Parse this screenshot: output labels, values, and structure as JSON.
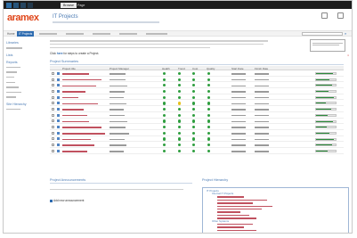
{
  "ribbon": {
    "tabs": [
      {
        "label": "Browse",
        "active": true
      },
      {
        "label": "Page",
        "active": false
      }
    ]
  },
  "header": {
    "logo": "aramex",
    "title": "IT Projects"
  },
  "tabs": [
    {
      "label": "Home",
      "active": false
    },
    {
      "label": "IT Projects",
      "active": true
    },
    {
      "label": "",
      "active": false
    },
    {
      "label": "",
      "active": false
    },
    {
      "label": "",
      "active": false
    },
    {
      "label": "",
      "active": false
    },
    {
      "label": "",
      "active": false
    }
  ],
  "nav": {
    "sections": [
      {
        "heading": "Libraries",
        "items": [
          ""
        ]
      },
      {
        "heading": "Lists",
        "items": []
      },
      {
        "heading": "Reports",
        "items": [
          "",
          "",
          "",
          "",
          "",
          "",
          ""
        ]
      },
      {
        "heading": "Site Hierarchy",
        "items": [
          ""
        ]
      }
    ]
  },
  "main": {
    "intro_link_prefix": "Click ",
    "intro_link_bold": "here",
    "intro_link_suffix": " for steps to create a Project.",
    "summaries_title": "Project Summaries",
    "columns": [
      "Project title",
      "Project Manager",
      "Health",
      "Trend",
      "Cost",
      "Quality",
      "Start Date",
      "Finish Date"
    ],
    "announcements_title": "Project Announcements",
    "add_announcement": "Add new announcement",
    "hierarchy_title": "Project Hierarchy"
  },
  "colors": {
    "green": "#2f9e3f",
    "yellow": "#e6c01e",
    "red": "#d23a2a",
    "accent": "#2d6bb0",
    "logo": "#e0461a"
  },
  "projects": [
    {
      "status": [
        "green",
        "green",
        "green",
        "green"
      ],
      "progress": 0.85
    },
    {
      "status": [
        "green",
        "green",
        "green",
        "green"
      ],
      "progress": 0.7
    },
    {
      "status": [
        "green",
        "green",
        "green",
        "green"
      ],
      "progress": 0.8
    },
    {
      "status": [
        "green",
        "green",
        "green",
        "green"
      ],
      "progress": 0.65
    },
    {
      "status": [
        "green",
        "green",
        "green",
        "green"
      ],
      "progress": 0.9
    },
    {
      "status": [
        "green",
        "yellow",
        "green",
        "green"
      ],
      "progress": 0.5
    },
    {
      "status": [
        "green",
        "green",
        "green",
        "green"
      ],
      "progress": 0.75
    },
    {
      "status": [
        "green",
        "green",
        "green",
        "green"
      ],
      "progress": 0.6
    },
    {
      "status": [
        "green",
        "green",
        "green",
        "green"
      ],
      "progress": 0.85
    },
    {
      "status": [
        "green",
        "green",
        "green",
        "green"
      ],
      "progress": 0.55
    },
    {
      "status": [
        "green",
        "green",
        "green",
        "green"
      ],
      "progress": 0.7
    },
    {
      "status": [
        "green",
        "green",
        "green",
        "green"
      ],
      "progress": 0.9
    },
    {
      "status": [
        "green",
        "green",
        "green",
        "green"
      ],
      "progress": 0.8
    },
    {
      "status": [
        "green",
        "green",
        "green",
        "green"
      ],
      "progress": 0.6
    }
  ],
  "hierarchy": {
    "root": "IT Projects",
    "level1": [
      "Internal IT Projects",
      "Other Systems"
    ]
  }
}
